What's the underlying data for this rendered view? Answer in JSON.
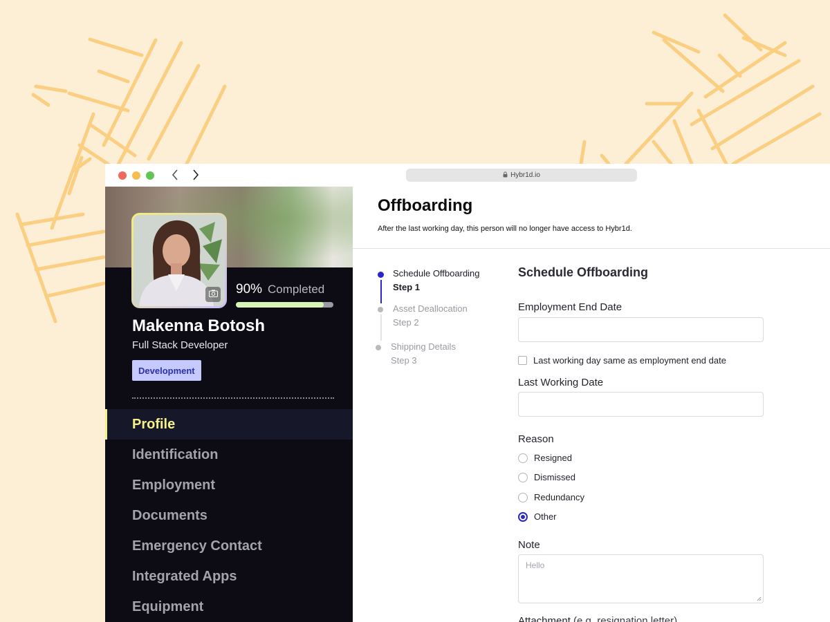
{
  "browser": {
    "url": "Hybr1d.io"
  },
  "profile": {
    "progress_percent_label": "90%",
    "progress_fraction": 0.9,
    "progress_suffix": "Completed",
    "name": "Makenna Botosh",
    "job_title": "Full Stack Developer",
    "department": "Development",
    "nav": [
      {
        "label": "Profile",
        "active": true
      },
      {
        "label": "Identification",
        "active": false
      },
      {
        "label": "Employment",
        "active": false
      },
      {
        "label": "Documents",
        "active": false
      },
      {
        "label": "Emergency Contact",
        "active": false
      },
      {
        "label": "Integrated Apps",
        "active": false
      },
      {
        "label": "Equipment",
        "active": false
      }
    ]
  },
  "offboarding": {
    "title": "Offboarding",
    "subtitle": "After the last working day, this person will no longer have access to Hybr1d.",
    "steps": [
      {
        "title": "Schedule Offboarding",
        "step": "Step 1",
        "active": true
      },
      {
        "title": "Asset Deallocation",
        "step": "Step 2",
        "active": false
      },
      {
        "title": "Shipping Details",
        "step": "Step 3",
        "active": false
      }
    ],
    "form": {
      "title": "Schedule Offboarding",
      "end_date_label": "Employment End Date",
      "end_date_value": "",
      "same_day_checkbox_label": "Last working day same as employment end date",
      "last_working_label": "Last Working Date",
      "last_working_value": "",
      "reason_label": "Reason",
      "reasons": [
        "Resigned",
        "Dismissed",
        "Redundancy",
        "Other"
      ],
      "selected_reason": "Other",
      "note_label": "Note",
      "note_placeholder": "Hello",
      "attachment_label": "Attachment",
      "attachment_hint": "(e.g. resignation letter)"
    }
  },
  "colors": {
    "background": "#fdeed6",
    "decor_stroke": "#fbcf82",
    "sidebar": "#0d0c14",
    "accent_blue": "#2b26c9",
    "active_yellow": "#f6f08a",
    "badge_bg": "#c5c9fc",
    "progress_fill": "#d7f5b6"
  }
}
